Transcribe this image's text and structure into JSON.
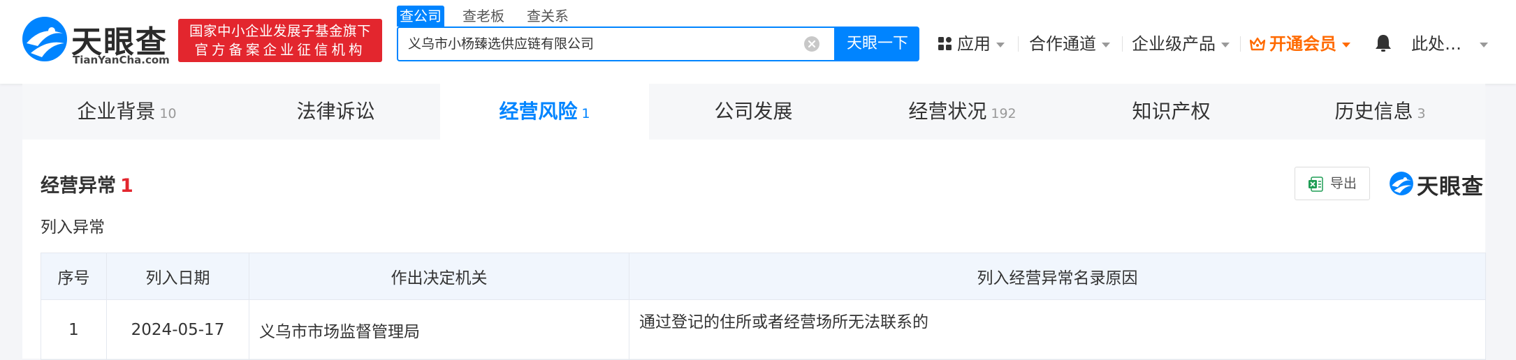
{
  "header": {
    "logo_text": "天眼查",
    "logo_domain": "TianYanCha.com",
    "slogan_line1": "国家中小企业发展子基金旗下",
    "slogan_line2": "官方备案企业征信机构",
    "search_tabs": [
      "查公司",
      "查老板",
      "查关系"
    ],
    "search_value": "义乌市小杨臻选供应链有限公司",
    "search_button": "天眼一下",
    "nav": {
      "apps": "应用",
      "cooperation": "合作通道",
      "enterprise": "企业级产品",
      "vip": "开通会员",
      "user": "此处…"
    },
    "colors": {
      "brand_blue": "#0084ff",
      "slogan_red": "#e3262e",
      "vip_orange": "#ff6a00"
    }
  },
  "tabs": [
    {
      "label": "企业背景",
      "count": "10"
    },
    {
      "label": "法律诉讼",
      "count": ""
    },
    {
      "label": "经营风险",
      "count": "1"
    },
    {
      "label": "公司发展",
      "count": ""
    },
    {
      "label": "经营状况",
      "count": "192"
    },
    {
      "label": "知识产权",
      "count": ""
    },
    {
      "label": "历史信息",
      "count": "3"
    }
  ],
  "section": {
    "title": "经营异常",
    "count": "1",
    "export_label": "导出",
    "watermark": "天眼查",
    "subtitle": "列入异常"
  },
  "table": {
    "headers": [
      "序号",
      "列入日期",
      "作出决定机关",
      "列入经营异常名录原因"
    ],
    "rows": [
      {
        "no": "1",
        "date": "2024-05-17",
        "authority": "义乌市市场监督管理局",
        "reason": "通过登记的住所或者经营场所无法联系的"
      }
    ]
  }
}
